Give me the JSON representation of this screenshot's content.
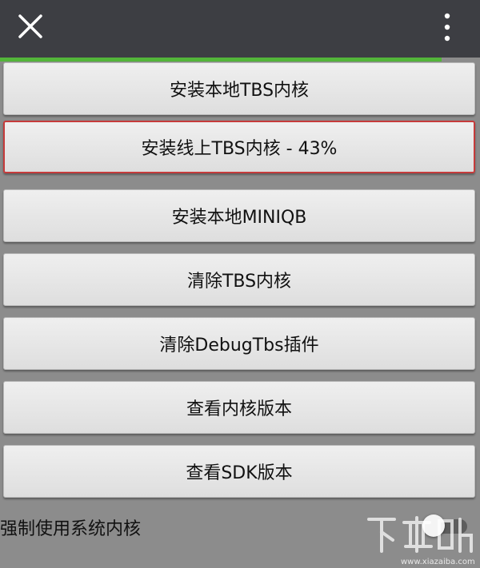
{
  "header": {
    "close_icon": "close-icon",
    "more_icon": "more-vertical-icon"
  },
  "progress": {
    "value": 0.92,
    "color": "#53b53a"
  },
  "buttons": [
    {
      "label": "安装本地TBS内核",
      "active": false
    },
    {
      "label": "安装线上TBS内核 - 43%",
      "active": true
    },
    {
      "label": "安装本地MINIQB",
      "active": false
    },
    {
      "label": "清除TBS内核",
      "active": false
    },
    {
      "label": "清除DebugTbs插件",
      "active": false
    },
    {
      "label": "查看内核版本",
      "active": false
    },
    {
      "label": "查看SDK版本",
      "active": false
    }
  ],
  "toggle": {
    "label": "强制使用系统内核",
    "state": "off"
  },
  "watermark": {
    "text": "下载吧",
    "url": "www.xiazaiba.com"
  },
  "colors": {
    "header_bg": "#3d3e43",
    "page_bg": "#8c8c8c",
    "highlight_border": "#c53b3b"
  }
}
